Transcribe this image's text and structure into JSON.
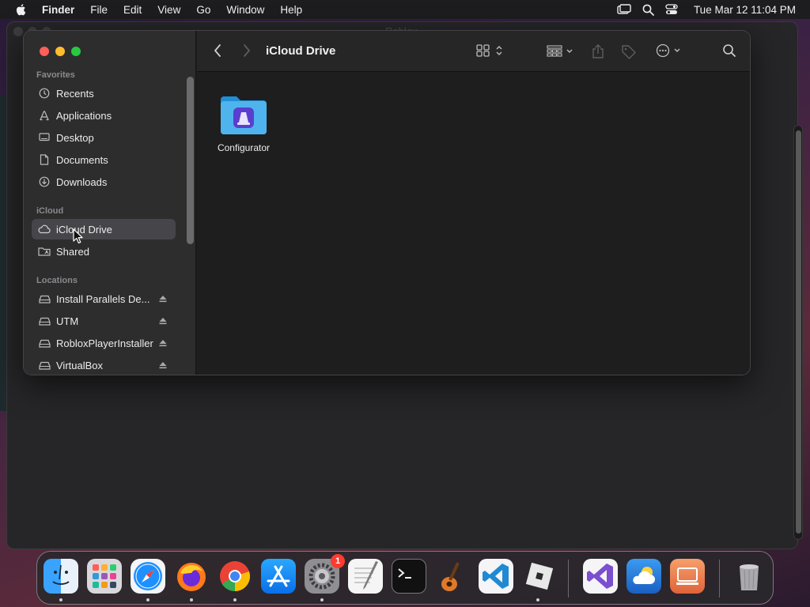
{
  "menubar": {
    "app_name": "Finder",
    "menus": [
      "File",
      "Edit",
      "View",
      "Go",
      "Window",
      "Help"
    ],
    "clock": "Tue Mar 12  11:04 PM"
  },
  "background_window": {
    "title": "Roblox"
  },
  "finder": {
    "location_title": "iCloud Drive",
    "sidebar": {
      "favorites_header": "Favorites",
      "favorites": [
        {
          "label": "Recents",
          "icon": "clock-icon"
        },
        {
          "label": "Applications",
          "icon": "applications-icon"
        },
        {
          "label": "Desktop",
          "icon": "desktop-icon"
        },
        {
          "label": "Documents",
          "icon": "document-icon"
        },
        {
          "label": "Downloads",
          "icon": "download-icon"
        }
      ],
      "icloud_header": "iCloud",
      "icloud": [
        {
          "label": "iCloud Drive",
          "icon": "cloud-icon",
          "selected": true
        },
        {
          "label": "Shared",
          "icon": "shared-folder-icon",
          "selected": false
        }
      ],
      "locations_header": "Locations",
      "locations": [
        {
          "label": "Install Parallels De...",
          "icon": "drive-icon"
        },
        {
          "label": "UTM",
          "icon": "drive-icon"
        },
        {
          "label": "RobloxPlayerInstaller",
          "icon": "drive-icon"
        },
        {
          "label": "VirtualBox",
          "icon": "drive-icon"
        }
      ]
    },
    "files": [
      {
        "name": "Configurator",
        "icon": "configurator-folder-icon"
      }
    ]
  },
  "dock": {
    "items": [
      {
        "name": "Finder",
        "icon": "finder-icon",
        "color": "#2f8cf5",
        "running": true
      },
      {
        "name": "Launchpad",
        "icon": "launchpad-icon",
        "color": "#d8d8dc",
        "running": false
      },
      {
        "name": "Safari",
        "icon": "safari-icon",
        "color": "#1e90ff",
        "running": true
      },
      {
        "name": "Firefox",
        "icon": "firefox-icon",
        "color": "#ff7a1a",
        "running": true
      },
      {
        "name": "Chrome",
        "icon": "chrome-icon",
        "color": "#ea4335",
        "running": true
      },
      {
        "name": "App Store",
        "icon": "app-store-icon",
        "color": "#1a8cff",
        "running": false
      },
      {
        "name": "System Settings",
        "icon": "settings-icon",
        "color": "#8e8e93",
        "running": true,
        "badge": "1"
      },
      {
        "name": "TextEdit",
        "icon": "textedit-icon",
        "color": "#f5f5f5",
        "running": false
      },
      {
        "name": "Terminal",
        "icon": "terminal-icon",
        "color": "#111111",
        "running": false
      },
      {
        "name": "GarageBand",
        "icon": "garageband-icon",
        "color": "#e07a2a",
        "running": false
      },
      {
        "name": "Visual Studio Code",
        "icon": "vscode-icon",
        "color": "#1f8ad2",
        "running": false
      },
      {
        "name": "Roblox",
        "icon": "roblox-icon",
        "color": "#e8e8e8",
        "running": true
      },
      {
        "name": "Visual Studio",
        "icon": "visual-studio-icon",
        "color": "#7b4fd0",
        "running": false
      },
      {
        "name": "Weather",
        "icon": "weather-icon",
        "color": "#2a7de1",
        "running": false
      },
      {
        "name": "Parallels Desktop",
        "icon": "parallels-icon",
        "color": "#f08a5d",
        "running": false
      },
      {
        "name": "Trash",
        "icon": "trash-icon",
        "color": "#9a9a9e",
        "running": false
      }
    ]
  }
}
